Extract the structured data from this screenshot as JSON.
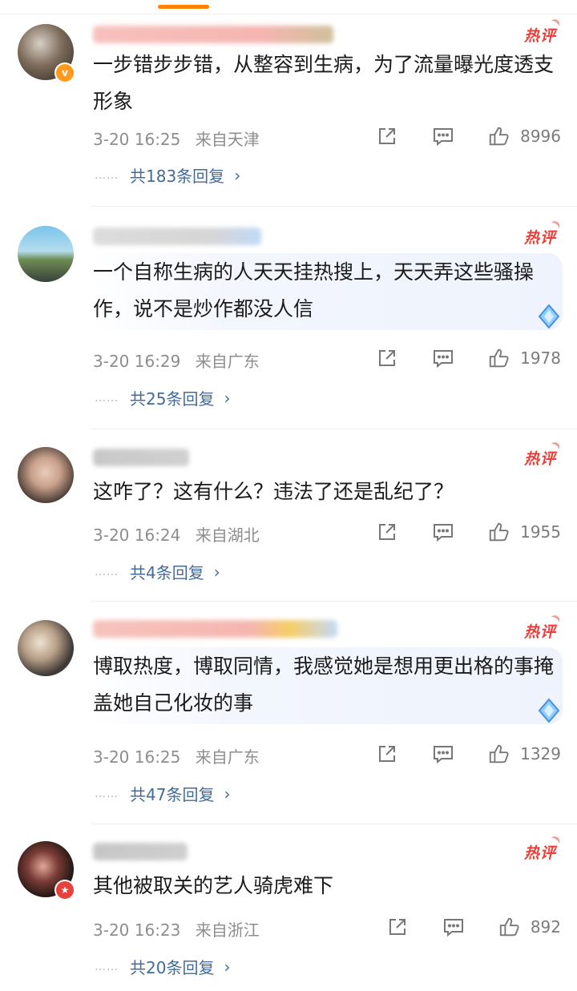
{
  "hot_label": "热评",
  "comments": [
    {
      "text": "一步错步步错，从整容到生病，为了流量曝光度透支形象",
      "time": "3-20 16:25",
      "location": "来自天津",
      "likes": "8996",
      "replies": "共183条回复"
    },
    {
      "text": "一个自称生病的人天天挂热搜上，天天弄这些骚操作，说不是炒作都没人信",
      "time": "3-20 16:29",
      "location": "来自广东",
      "likes": "1978",
      "replies": "共25条回复"
    },
    {
      "text": "这咋了？这有什么？违法了还是乱纪了？",
      "time": "3-20 16:24",
      "location": "来自湖北",
      "likes": "1955",
      "replies": "共4条回复"
    },
    {
      "text": "博取热度，博取同情，我感觉她是想用更出格的事掩盖她自己化妆的事",
      "time": "3-20 16:25",
      "location": "来自广东",
      "likes": "1329",
      "replies": "共47条回复"
    },
    {
      "text": "其他被取关的艺人骑虎难下",
      "time": "3-20 16:23",
      "location": "来自浙江",
      "likes": "892",
      "replies": "共20条回复"
    }
  ],
  "icons": {
    "share": "share-icon",
    "comment": "comment-icon",
    "like": "thumbs-up-icon",
    "verified": "verified-v-badge",
    "diamond": "diamond-badge-icon"
  },
  "colors": {
    "hot": "#e8403a",
    "reply_link": "#436b9a",
    "meta": "#8d8d8d",
    "accent": "#ff8200"
  }
}
